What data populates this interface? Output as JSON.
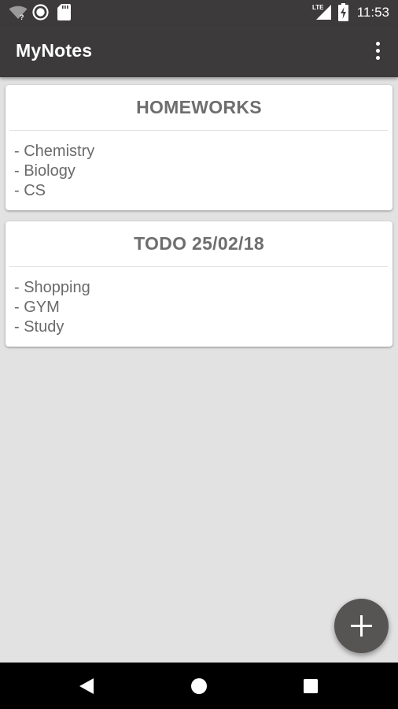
{
  "status_bar": {
    "time": "11:53",
    "network_label": "LTE",
    "icons": [
      "wifi-unknown-icon",
      "sync-circle-icon",
      "sd-card-icon",
      "lte-signal-icon",
      "battery-charging-icon"
    ]
  },
  "app_bar": {
    "title": "MyNotes",
    "menu_icon": "more-vert-icon"
  },
  "notes": [
    {
      "title": "HOMEWORKS",
      "lines": [
        "- Chemistry",
        "- Biology",
        "- CS"
      ]
    },
    {
      "title": "TODO 25/02/18",
      "lines": [
        "- Shopping",
        "- GYM",
        "- Study"
      ]
    }
  ],
  "fab": {
    "icon": "add-icon"
  },
  "nav_bar": {
    "buttons": [
      "back-icon",
      "home-icon",
      "recents-icon"
    ]
  },
  "colors": {
    "app_bar": "#3c3a3a",
    "background": "#e2e2e2",
    "card": "#ffffff",
    "note_text": "#6e6e6e",
    "fab": "#575454",
    "nav_bar": "#000000"
  }
}
